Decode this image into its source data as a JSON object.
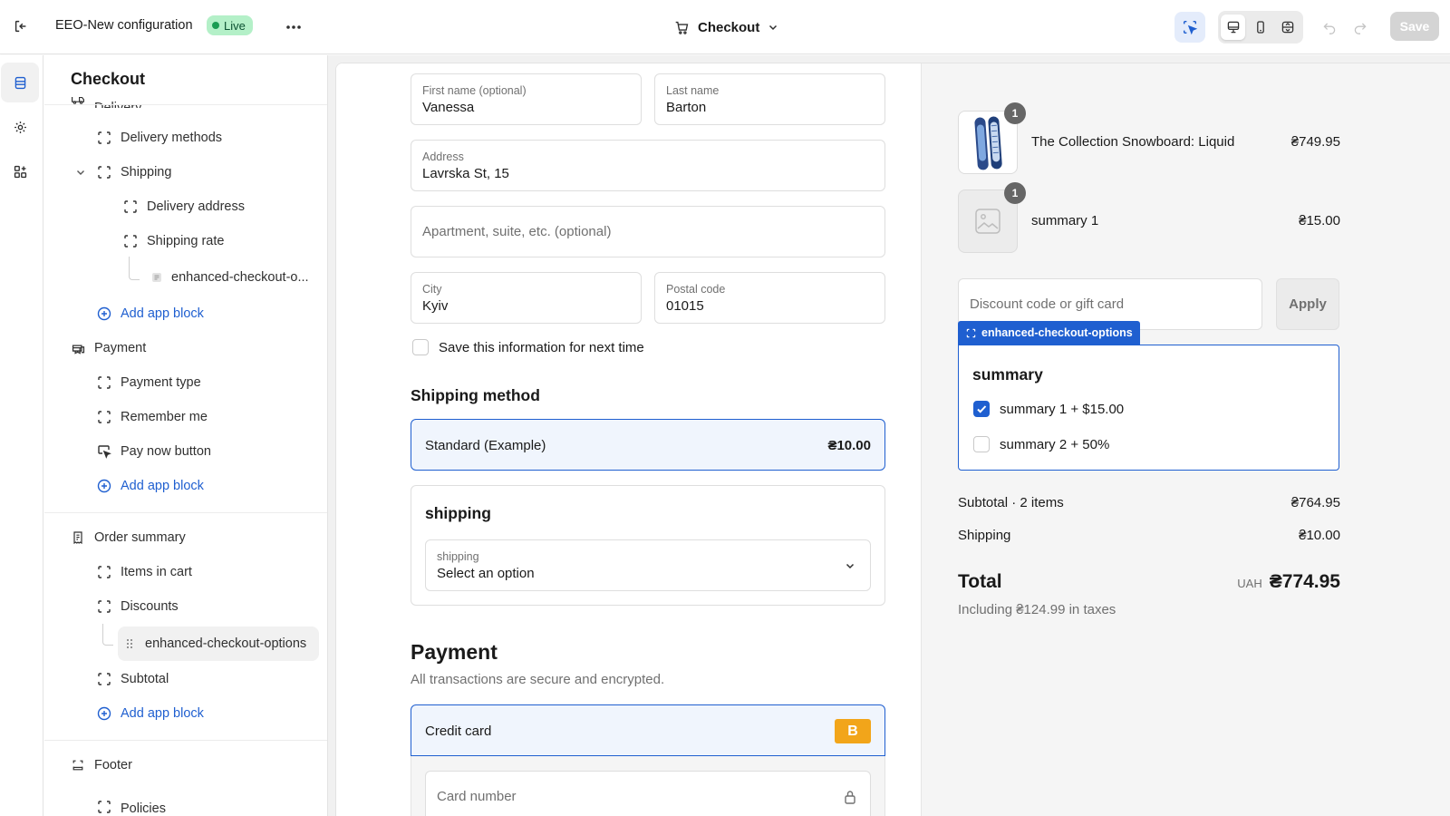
{
  "topbar": {
    "config_name": "EEO-New configuration",
    "status_badge": "Live",
    "page_selector": "Checkout",
    "save_label": "Save"
  },
  "sidebar": {
    "title": "Checkout",
    "delivery_partial": "Delivery",
    "delivery_methods": "Delivery methods",
    "shipping": "Shipping",
    "delivery_address": "Delivery address",
    "shipping_rate": "Shipping rate",
    "shipping_app_block": "enhanced-checkout-o...",
    "add_app_block_1": "Add app block",
    "payment": "Payment",
    "payment_type": "Payment type",
    "remember_me": "Remember me",
    "pay_now_button": "Pay now button",
    "add_app_block_2": "Add app block",
    "order_summary": "Order summary",
    "items_in_cart": "Items in cart",
    "discounts": "Discounts",
    "discounts_app_block": "enhanced-checkout-options",
    "subtotal": "Subtotal",
    "add_app_block_3": "Add app block",
    "footer": "Footer",
    "policies_partial": "Policies"
  },
  "form": {
    "first_name_label": "First name (optional)",
    "first_name_value": "Vanessa",
    "last_name_label": "Last name",
    "last_name_value": "Barton",
    "address_label": "Address",
    "address_value": "Lavrska St, 15",
    "apartment_placeholder": "Apartment, suite, etc. (optional)",
    "city_label": "City",
    "city_value": "Kyiv",
    "postal_label": "Postal code",
    "postal_value": "01015",
    "save_info_label": "Save this information for next time",
    "shipping_method_heading": "Shipping method",
    "shipping_option_name": "Standard (Example)",
    "shipping_option_price": "₴10.00",
    "shipping_block_title": "shipping",
    "shipping_select_label": "shipping",
    "shipping_select_value": "Select an option",
    "payment_heading": "Payment",
    "payment_subtitle": "All transactions are secure and encrypted.",
    "credit_card_label": "Credit card",
    "card_brand": "B",
    "card_number_placeholder": "Card number"
  },
  "summary": {
    "items": [
      {
        "name": "The Collection Snowboard: Liquid",
        "price": "₴749.95",
        "qty": "1"
      },
      {
        "name": "summary 1",
        "price": "₴15.00",
        "qty": "1"
      }
    ],
    "discount_placeholder": "Discount code or gift card",
    "apply_label": "Apply",
    "block_tag": "enhanced-checkout-options",
    "block_title": "summary",
    "options": [
      {
        "label": "summary 1 + $15.00",
        "checked": true
      },
      {
        "label": "summary 2 + 50%",
        "checked": false
      }
    ],
    "subtotal_label": "Subtotal · 2 items",
    "subtotal_value": "₴764.95",
    "shipping_label": "Shipping",
    "shipping_value": "₴10.00",
    "total_label": "Total",
    "currency": "UAH",
    "total_value": "₴774.95",
    "taxes_note": "Including ₴124.99 in taxes"
  },
  "colors": {
    "accent": "#1f5fd0",
    "selected_bg": "#f0f5fd",
    "live_badge": "#b4f0c8",
    "card_brand_bg": "#f2a51a"
  }
}
